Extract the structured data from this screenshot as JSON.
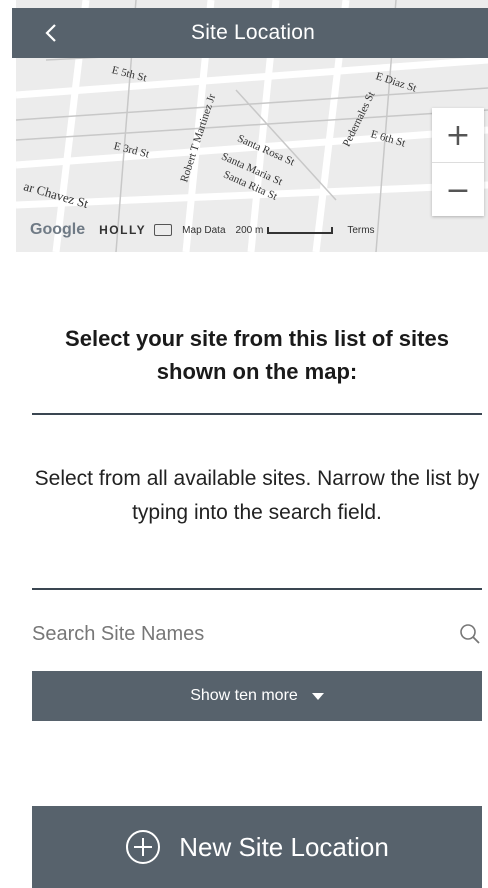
{
  "header": {
    "title": "Site Location",
    "back_icon": "chevron-left-icon"
  },
  "map": {
    "streets": [
      "E 5th St",
      "E 3rd St",
      "Robert T Martinez Jr",
      "Santa Rosa St",
      "Santa Maria St",
      "Santa Rita St",
      "Pedernales St",
      "E Diaz St",
      "E 6th St",
      "ar Chavez St"
    ],
    "zoom_in": "+",
    "zoom_out": "−",
    "attribution": {
      "logo": "Google",
      "area": "HOLLY",
      "map_data": "Map Data",
      "scale": "200 m",
      "terms": "Terms"
    }
  },
  "prompt": "Select your site from this list of sites shown on the map:",
  "instructions": "Select from all available sites. Narrow the list by typing into the search field.",
  "search": {
    "placeholder": "Search Site Names",
    "value": ""
  },
  "show_more_label": "Show ten more",
  "new_site_label": "New Site Location",
  "colors": {
    "bar": "#57626c",
    "divider": "#3a4651",
    "map_bg": "#ececec"
  }
}
